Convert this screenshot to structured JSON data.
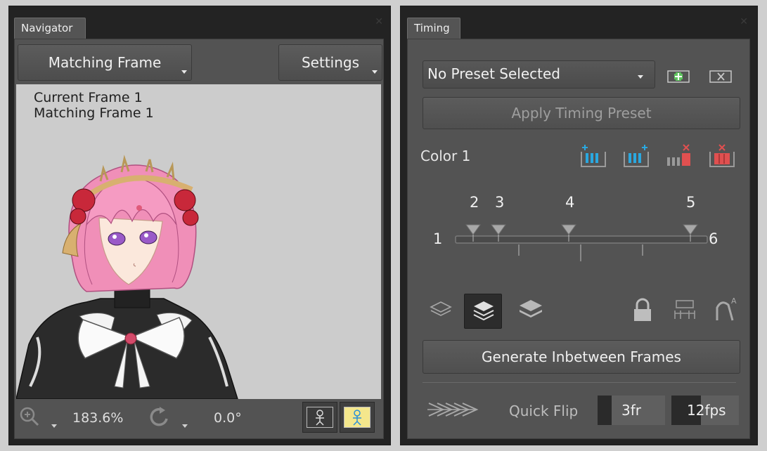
{
  "navigator": {
    "tab_label": "Navigator",
    "matching_frame_button": "Matching Frame",
    "settings_button": "Settings",
    "current_frame_text": "Current Frame 1",
    "matching_frame_text": "Matching Frame 1",
    "zoom_value": "183.6%",
    "rotation_value": "0.0°",
    "icons": [
      "zoom-icon",
      "rotate-icon",
      "onion-skin-toggle-icon",
      "matching-frame-toggle-icon"
    ]
  },
  "timing": {
    "tab_label": "Timing",
    "preset_select_value": "No Preset Selected",
    "apply_button": "Apply Timing Preset",
    "color_label": "Color 1",
    "timeline": {
      "start_label": "1",
      "end_label": "6",
      "markers": [
        "2",
        "3",
        "4",
        "5"
      ]
    },
    "generate_button": "Generate Inbetween Frames",
    "quick_flip_label": "Quick Flip",
    "quick_flip_frames": "3fr",
    "quick_flip_fps": "12fps",
    "accent_colors": {
      "add": "#2aa8e0",
      "delete": "#e05050",
      "new_preset": "#5ec45e"
    }
  }
}
